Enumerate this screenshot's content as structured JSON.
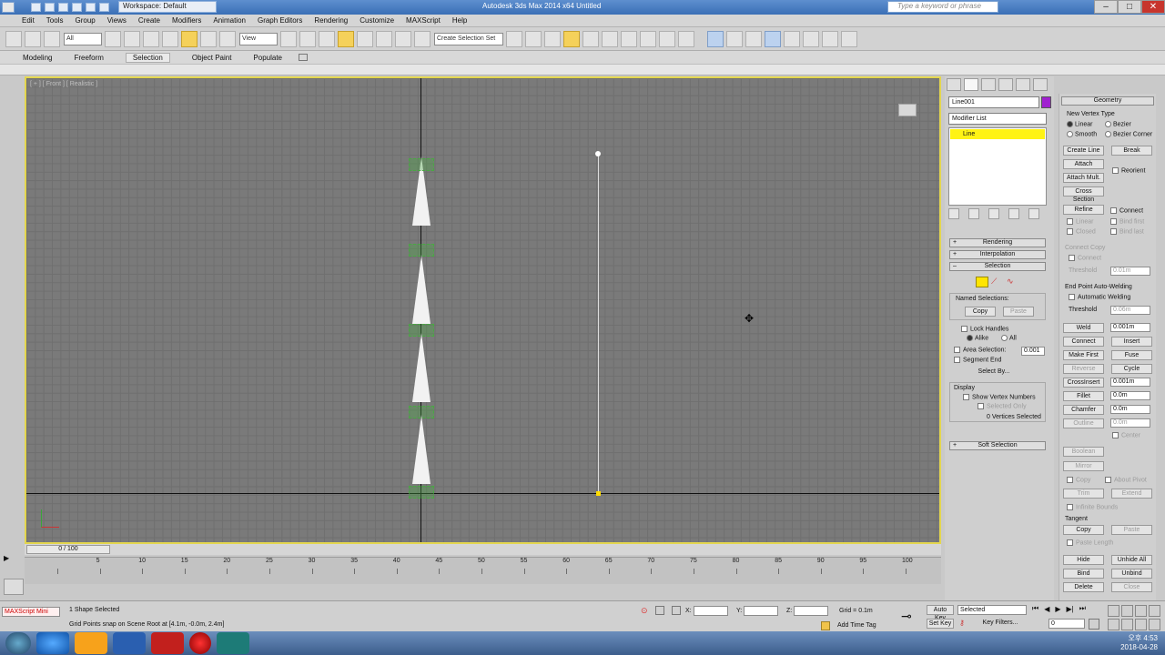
{
  "titlebar": {
    "workspace_label": "Workspace: Default",
    "app_title": "Autodesk 3ds Max  2014 x64      Untitled",
    "search_placeholder": "Type a keyword or phrase"
  },
  "menu": [
    "Edit",
    "Tools",
    "Group",
    "Views",
    "Create",
    "Modifiers",
    "Animation",
    "Graph Editors",
    "Rendering",
    "Customize",
    "MAXScript",
    "Help"
  ],
  "toolbar": {
    "selection_filter": "All",
    "ref_coord": "View",
    "named_selection": "Create Selection Set"
  },
  "ribbon": {
    "tabs": [
      "Modeling",
      "Freeform",
      "Selection",
      "Object Paint",
      "Populate"
    ],
    "active_tab": "Selection"
  },
  "viewport": {
    "label": "[ + ] [ Front ] [ Realistic ]"
  },
  "command_panel": {
    "object_name": "Line001",
    "object_color": "#a020d0",
    "modifier_list": "Modifier List",
    "stack_item": "Line",
    "rollouts": {
      "rendering": "Rendering",
      "interpolation": "Interpolation",
      "selection": "Selection",
      "soft_selection": "Soft Selection"
    },
    "selection": {
      "named_selections": "Named Selections:",
      "copy": "Copy",
      "paste": "Paste",
      "lock_handles": "Lock Handles",
      "alike": "Alike",
      "all": "All",
      "area_selection": "Area Selection:",
      "area_value": "0.001",
      "segment_end": "Segment End",
      "select_by": "Select By...",
      "display": "Display",
      "show_vertex_numbers": "Show Vertex Numbers",
      "selected_only": "Selected Only",
      "status": "0 Vertices Selected"
    }
  },
  "geometry": {
    "title": "Geometry",
    "new_vertex_type": "New Vertex Type",
    "linear": "Linear",
    "bezier": "Bezier",
    "smooth": "Smooth",
    "bezier_corner": "Bezier Corner",
    "create_line": "Create Line",
    "break": "Break",
    "attach": "Attach",
    "reorient": "Reorient",
    "attach_mult": "Attach Mult.",
    "cross_section": "Cross Section",
    "refine": "Refine",
    "connect": "Connect",
    "linear2": "Linear",
    "bind_first": "Bind first",
    "closed": "Closed",
    "bind_last": "Bind last",
    "connect_copy": "Connect Copy",
    "connect2": "Connect",
    "threshold": "Threshold",
    "threshold_val": "0.01m",
    "end_point_welding": "End Point Auto-Welding",
    "automatic_welding": "Automatic Welding",
    "threshold2": "Threshold",
    "threshold2_val": "0.06m",
    "weld": "Weld",
    "weld_val": "0.001m",
    "connect3": "Connect",
    "insert": "Insert",
    "make_first": "Make First",
    "fuse": "Fuse",
    "reverse": "Reverse",
    "cycle": "Cycle",
    "crossinsert": "CrossInsert",
    "crossinsert_val": "0.001m",
    "fillet": "Fillet",
    "fillet_val": "0.0m",
    "chamfer": "Chamfer",
    "chamfer_val": "0.0m",
    "outline": "Outline",
    "outline_val": "0.0m",
    "center": "Center",
    "boolean": "Boolean",
    "mirror": "Mirror",
    "copy": "Copy",
    "about_pivot": "About Pivot",
    "trim": "Trim",
    "extend": "Extend",
    "infinite_bounds": "Infinite Bounds",
    "tangent": "Tangent",
    "tcopy": "Copy",
    "tpaste": "Paste",
    "paste_length": "Paste Length",
    "hide": "Hide",
    "unhide_all": "Unhide All",
    "bind": "Bind",
    "unbind": "Unbind",
    "delete": "Delete",
    "close": "Close"
  },
  "timeline": {
    "frame_indicator": "0 / 100",
    "ticks": [
      "0",
      "5",
      "10",
      "15",
      "20",
      "25",
      "30",
      "35",
      "40",
      "45",
      "50",
      "55",
      "60",
      "65",
      "70",
      "75",
      "80",
      "85",
      "90",
      "95",
      "100"
    ]
  },
  "status": {
    "maxscript": "MAXScript Mini",
    "selected": "1 Shape Selected",
    "prompt": "Grid Points snap on Scene Root at [4.1m, -0.0m, 2.4m]",
    "x_label": "X:",
    "y_label": "Y:",
    "z_label": "Z:",
    "grid": "Grid = 0.1m",
    "add_time_tag": "Add Time Tag",
    "auto_key": "Auto Key",
    "set_key": "Set Key",
    "key_mode": "Selected",
    "key_filters": "Key Filters...",
    "frame": "0"
  },
  "taskbar": {
    "time": "오후 4:53",
    "date": "2018-04-28"
  }
}
